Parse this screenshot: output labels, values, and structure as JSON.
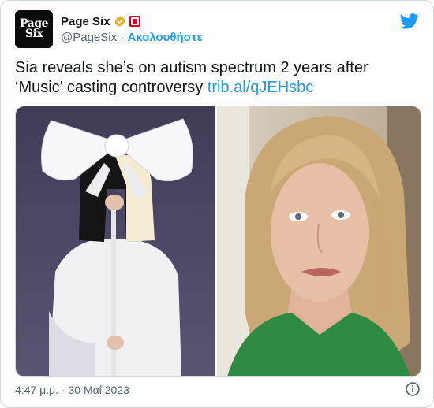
{
  "account": {
    "display_name": "Page Six",
    "handle": "@PageSix",
    "separator": " · ",
    "follow_label": "Ακολουθήστε",
    "avatar_line1": "Page",
    "avatar_line2": "Six",
    "verified": true
  },
  "tweet": {
    "text": "Sia reveals she’s on autism spectrum 2 years after ‘Music’ casting controversy ",
    "link": "trib.al/qJEHsbc"
  },
  "footer": {
    "timestamp": "4:47 μ.μ. · 30 Μαΐ 2023"
  },
  "colors": {
    "accent": "#1d9bf0",
    "verified_badge": "#e8b32c",
    "affiliation_badge": "#d1001f",
    "text": "#0f1419",
    "muted": "#536471"
  },
  "icons": {
    "logo": "twitter-bird-icon",
    "info": "info-circle-icon",
    "verified": "verified-badge-icon"
  }
}
